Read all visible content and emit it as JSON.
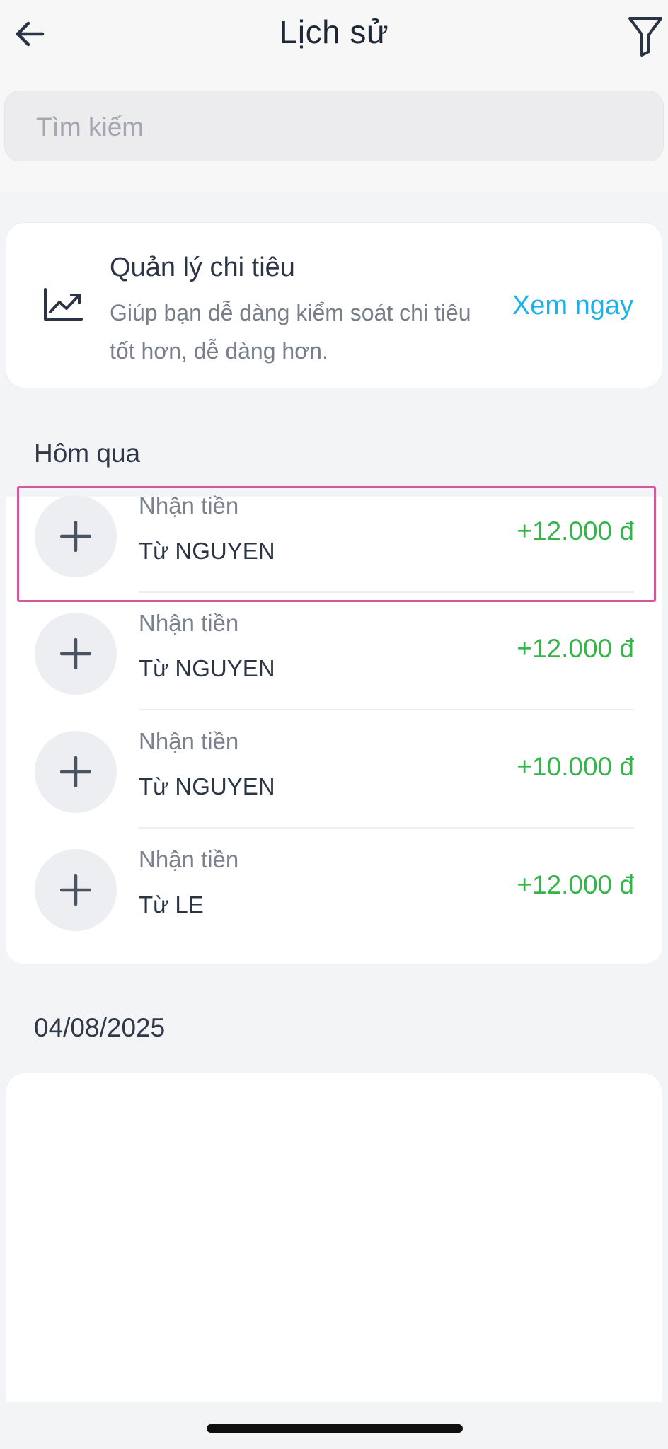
{
  "header": {
    "title": "Lịch sử"
  },
  "search": {
    "placeholder": "Tìm kiếm",
    "value": ""
  },
  "promo": {
    "title": "Quản lý chi tiêu",
    "description": "Giúp bạn dễ dàng kiểm soát chi tiêu tốt hơn, dễ dàng hơn.",
    "cta": "Xem ngay",
    "icon": "trend-chart-icon"
  },
  "sections": [
    {
      "label": "Hôm qua",
      "transactions": [
        {
          "type": "Nhận tiền",
          "from": "Từ NGUYEN",
          "amount": "+12.000 đ"
        },
        {
          "type": "Nhận tiền",
          "from": "Từ NGUYEN",
          "amount": "+12.000 đ"
        },
        {
          "type": "Nhận tiền",
          "from": "Từ NGUYEN",
          "amount": "+10.000 đ"
        },
        {
          "type": "Nhận tiền",
          "from": "Từ LE",
          "amount": "+12.000 đ"
        }
      ]
    },
    {
      "label": "04/08/2025",
      "transactions": []
    }
  ],
  "colors": {
    "accent": "#1ab2e8",
    "positive_amount": "#34b449",
    "highlight_border": "#d6589a"
  }
}
